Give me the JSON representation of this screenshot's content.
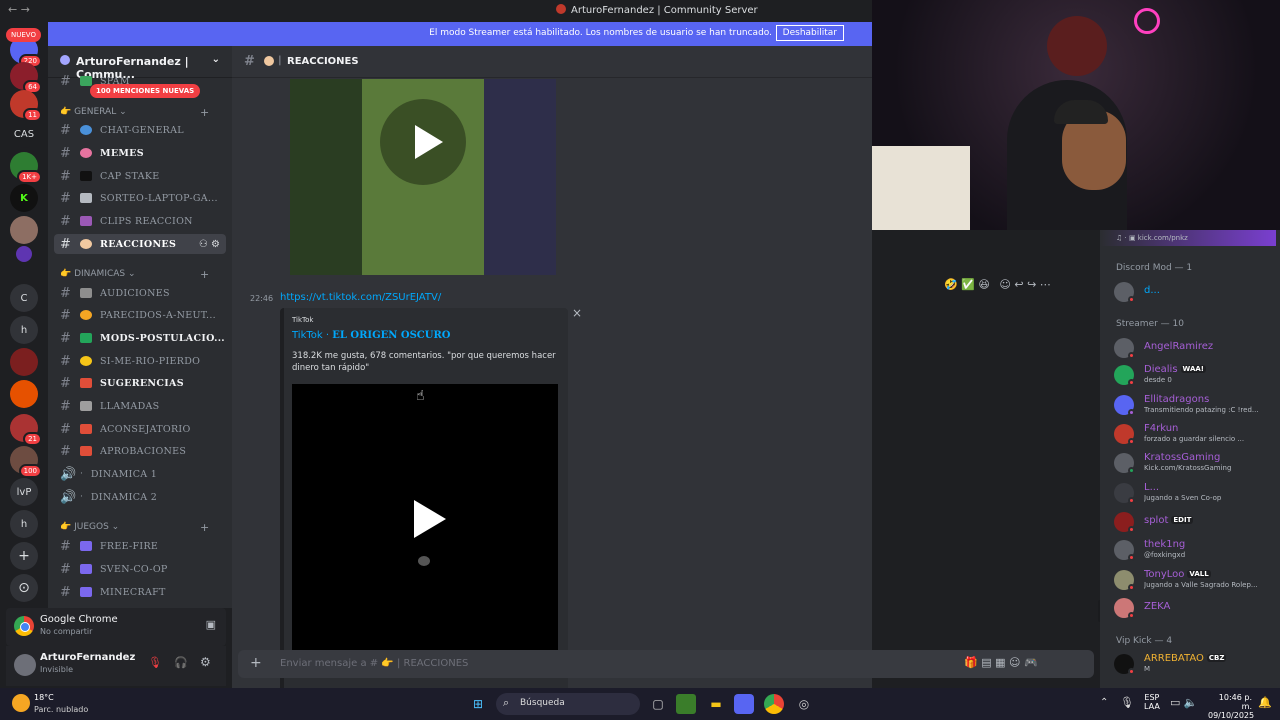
{
  "window": {
    "title": "ArturoFernandez | Community Server"
  },
  "streamer_banner": {
    "text": "El modo Streamer está habilitado. Los nombres de usuario se han truncado.",
    "button": "Deshabilitar"
  },
  "servers": {
    "new_label": "NUEVO",
    "items": [
      {
        "label": "",
        "badge": "220"
      },
      {
        "label": "",
        "badge": "64"
      },
      {
        "label": "",
        "badge": "11"
      },
      {
        "label": "CAS",
        "badge": ""
      },
      {
        "label": "",
        "badge": "1K+"
      },
      {
        "label": "K",
        "badge": ""
      },
      {
        "label": "",
        "badge": ""
      },
      {
        "label": "",
        "badge": ""
      },
      {
        "label": "C",
        "badge": ""
      },
      {
        "label": "h",
        "badge": ""
      },
      {
        "label": "",
        "badge": ""
      },
      {
        "label": "",
        "badge": ""
      },
      {
        "label": "",
        "badge": "21"
      },
      {
        "label": "",
        "badge": "100"
      },
      {
        "label": "lvP",
        "badge": ""
      },
      {
        "label": "h",
        "badge": ""
      },
      {
        "label": "+",
        "badge": ""
      },
      {
        "label": "⊙",
        "badge": ""
      }
    ]
  },
  "guild": {
    "name": "ArturoFernandez | Commu...",
    "mentions": "100 MENCIONES NUEVAS"
  },
  "categories": {
    "general": "GENERAL",
    "dinamicas": "DINAMICAS",
    "juegos": "JUEGOS"
  },
  "channels": [
    {
      "name": "SPAM",
      "color": "#3ba55d"
    },
    {
      "name": "CHAT-GENERAL",
      "color": "#4a90d9"
    },
    {
      "name": "MEMES",
      "color": "#e6739f"
    },
    {
      "name": "CAP  STAKE",
      "color": "#111111"
    },
    {
      "name": "SORTEO-LAPTOP-GA...",
      "color": "#b5bac1"
    },
    {
      "name": "CLIPS  REACCION",
      "color": "#9b59b6"
    },
    {
      "name": "REACCIONES",
      "color": "#f0c8a0"
    },
    {
      "name": "AUDICIONES",
      "color": "#8e8e8e"
    },
    {
      "name": "PARECIDOS-A-NEUT...",
      "color": "#f5a623"
    },
    {
      "name": "MODS-POSTULACIO...",
      "color": "#23a55a"
    },
    {
      "name": "SI-ME-RIO-PIERDO",
      "color": "#f5c518"
    },
    {
      "name": "SUGERENCIAS",
      "color": "#e04e39"
    },
    {
      "name": "LLAMADAS",
      "color": "#9e9e9e"
    },
    {
      "name": "ACONSEJATORIO",
      "color": "#e04e39"
    },
    {
      "name": "APROBACIONES",
      "color": "#e04e39"
    },
    {
      "name": "DINAMICA 1",
      "color": "#dbdee1"
    },
    {
      "name": "DINAMICA 2",
      "color": "#dbdee1"
    },
    {
      "name": "FREE-FIRE",
      "color": "#7b68ee"
    },
    {
      "name": "SVEN-CO-OP",
      "color": "#7b68ee"
    },
    {
      "name": "MINECRAFT",
      "color": "#7b68ee"
    }
  ],
  "voice": {
    "app": "Google Chrome",
    "status": "No compartir"
  },
  "user": {
    "name": "ArturoFernandez",
    "status": "Invisible"
  },
  "header": {
    "channel": "REACCIONES"
  },
  "message": {
    "time": "22:46",
    "link": "https://vt.tiktok.com/ZSUrEJATV/",
    "embed_provider": "TikTok",
    "embed_title_prefix": "TikTok · ",
    "embed_title": "EL ORIGEN OSCURO",
    "embed_desc": "318.2K me gusta, 678 comentarios. \"por que queremos hacer dinero tan rápido\"",
    "close": "×"
  },
  "composer": {
    "placeholder_prefix": "Enviar mensaje a #",
    "channel": "REACCIONES"
  },
  "members": {
    "top_status": "kick.com/pnkz",
    "groups": [
      {
        "label": "Discord Mod — 1"
      },
      {
        "label": "Streamer — 10"
      },
      {
        "label": "Vip Kick — 4"
      }
    ],
    "list": [
      {
        "name": "d...",
        "status": "",
        "tag": "",
        "color": "#00a8fc"
      },
      {
        "name": "AngelRamirez",
        "status": "",
        "tag": "",
        "color": "#a65fd6"
      },
      {
        "name": "Diealis",
        "status": "desde 0",
        "tag": "WAA!",
        "color": "#a65fd6"
      },
      {
        "name": "Ellitadragons",
        "status": "Transmitiendo patazing :C !red...",
        "tag": "",
        "color": "#a65fd6"
      },
      {
        "name": "F4rkun",
        "status": "forzado a guardar silencio ...",
        "tag": "",
        "color": "#a65fd6"
      },
      {
        "name": "KratossGaming",
        "status": "Kick.com/KratossGaming",
        "tag": "",
        "color": "#a65fd6"
      },
      {
        "name": "L...",
        "status": "Jugando a Sven Co-op",
        "tag": "",
        "color": "#a65fd6"
      },
      {
        "name": "splot",
        "status": "",
        "tag": "EDIT",
        "color": "#a65fd6"
      },
      {
        "name": "thek1ng",
        "status": "@foxkingxd",
        "tag": "",
        "color": "#a65fd6"
      },
      {
        "name": "TonyLoo",
        "status": "Jugando a Valle Sagrado Rolep...",
        "tag": "VALL",
        "color": "#a65fd6"
      },
      {
        "name": "ZEKA",
        "status": "",
        "tag": "",
        "color": "#a65fd6"
      },
      {
        "name": "ARREBATAO",
        "status": "M",
        "tag": "CBZ",
        "color": "#f0b232"
      }
    ]
  },
  "taskbar": {
    "temp": "18°C",
    "weather": "Parc. nublado",
    "search": "Búsqueda",
    "lang1": "ESP",
    "lang2": "LAA",
    "time": "10:46 p. m.",
    "date": "09/10/2025"
  }
}
